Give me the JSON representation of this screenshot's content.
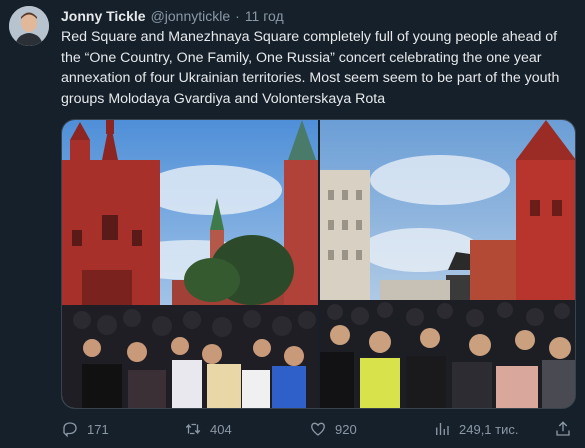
{
  "author": {
    "name": "Jonny Tickle",
    "handle": "@jonnytickle",
    "separator": "·",
    "time": "11 год"
  },
  "tweet": {
    "text": "Red Square and Manezhnaya Square completely full of young people ahead of the “One Country, One Family, One Russia” concert celebrating the one year annexation of four Ukrainian territories. Most seem seem to be part of the youth groups Molodaya Gvardiya and Volonterskaya Rota"
  },
  "stats": {
    "replies": "171",
    "retweets": "404",
    "likes": "920",
    "views": "249,1 тис."
  },
  "icons": {
    "reply": "reply-icon",
    "retweet": "retweet-icon",
    "like": "heart-icon",
    "views": "views-chart-icon",
    "share": "share-icon"
  },
  "colors": {
    "background": "#15202b",
    "text": "#e7e9ea",
    "muted": "#8b98a5",
    "border": "#38444d"
  }
}
